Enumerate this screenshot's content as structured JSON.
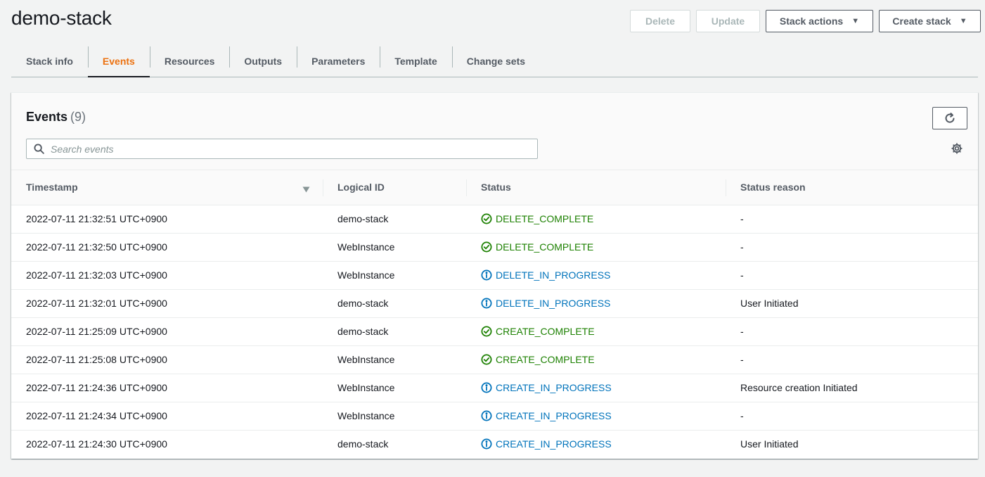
{
  "page": {
    "title": "demo-stack"
  },
  "actions": {
    "delete": "Delete",
    "update": "Update",
    "stack_actions": "Stack actions",
    "create_stack": "Create stack"
  },
  "tabs": [
    {
      "label": "Stack info",
      "active": false
    },
    {
      "label": "Events",
      "active": true
    },
    {
      "label": "Resources",
      "active": false
    },
    {
      "label": "Outputs",
      "active": false
    },
    {
      "label": "Parameters",
      "active": false
    },
    {
      "label": "Template",
      "active": false
    },
    {
      "label": "Change sets",
      "active": false
    }
  ],
  "events": {
    "title": "Events",
    "count": "(9)",
    "search_placeholder": "Search events",
    "columns": [
      "Timestamp",
      "Logical ID",
      "Status",
      "Status reason"
    ],
    "rows": [
      {
        "timestamp": "2022-07-11 21:32:51 UTC+0900",
        "logical_id": "demo-stack",
        "status": "DELETE_COMPLETE",
        "status_type": "complete",
        "reason": "-"
      },
      {
        "timestamp": "2022-07-11 21:32:50 UTC+0900",
        "logical_id": "WebInstance",
        "status": "DELETE_COMPLETE",
        "status_type": "complete",
        "reason": "-"
      },
      {
        "timestamp": "2022-07-11 21:32:03 UTC+0900",
        "logical_id": "WebInstance",
        "status": "DELETE_IN_PROGRESS",
        "status_type": "in-progress",
        "reason": "-"
      },
      {
        "timestamp": "2022-07-11 21:32:01 UTC+0900",
        "logical_id": "demo-stack",
        "status": "DELETE_IN_PROGRESS",
        "status_type": "in-progress",
        "reason": "User Initiated"
      },
      {
        "timestamp": "2022-07-11 21:25:09 UTC+0900",
        "logical_id": "demo-stack",
        "status": "CREATE_COMPLETE",
        "status_type": "complete",
        "reason": "-"
      },
      {
        "timestamp": "2022-07-11 21:25:08 UTC+0900",
        "logical_id": "WebInstance",
        "status": "CREATE_COMPLETE",
        "status_type": "complete",
        "reason": "-"
      },
      {
        "timestamp": "2022-07-11 21:24:36 UTC+0900",
        "logical_id": "WebInstance",
        "status": "CREATE_IN_PROGRESS",
        "status_type": "in-progress",
        "reason": "Resource creation Initiated"
      },
      {
        "timestamp": "2022-07-11 21:24:34 UTC+0900",
        "logical_id": "WebInstance",
        "status": "CREATE_IN_PROGRESS",
        "status_type": "in-progress",
        "reason": "-"
      },
      {
        "timestamp": "2022-07-11 21:24:30 UTC+0900",
        "logical_id": "demo-stack",
        "status": "CREATE_IN_PROGRESS",
        "status_type": "in-progress",
        "reason": "User Initiated"
      }
    ]
  },
  "icons": {
    "complete": "check-circle-icon",
    "in_progress": "info-circle-icon",
    "refresh": "refresh-icon",
    "settings": "gear-icon",
    "search": "search-icon",
    "sort": "sort-down-icon"
  },
  "colors": {
    "accent": "#ec7211",
    "success": "#1d8102",
    "info": "#0073bb"
  }
}
